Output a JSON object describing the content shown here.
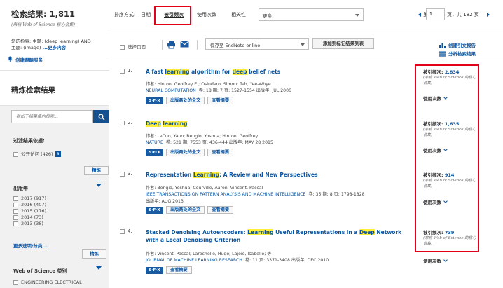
{
  "sidebar": {
    "results_title": "检索结果: 1,811",
    "results_source": "(来自 Web of Science 核心合集)",
    "query_prefix": "您的检索: 主题: (deep learning) AND",
    "query_line2": "主题: (image)",
    "query_more": "...更多内容",
    "create_alert": "创建跟踪服务",
    "refine_title": "精炼检索结果",
    "search_placeholder": "在如下结果集内检索...",
    "filter_label": "过滤结果依据:",
    "open_access": "公开访问 (426)",
    "refine_btn": "精炼",
    "year_label": "出版年",
    "years": [
      "2017 (917)",
      "2016 (407)",
      "2015 (176)",
      "2014 (73)",
      "2013 (38)"
    ],
    "more_options": "更多选项/分类...",
    "wos_category_label": "Web of Science 类别",
    "category_item": "ENGINEERING ELECTRICAL"
  },
  "sortbar": {
    "label": "排序方式:",
    "date": "日期",
    "times_cited": "被引频次",
    "usage": "使用次数",
    "relevance": "相关性",
    "more": "更多",
    "page_prefix": "第",
    "page_value": "1",
    "page_suffix": "页，共 182 页"
  },
  "toolbar": {
    "select_page": "选择页面",
    "endnote": "保存至 EndNote online",
    "add_marked": "添加到标记结果列表",
    "citation_report": "创建引文报告",
    "analyze": "分析检索结果"
  },
  "record_buttons": {
    "sfx": "S·F·X",
    "full_text": "出版商处的全文",
    "abstract": "查看摘要"
  },
  "records": [
    {
      "num": "1.",
      "title_parts": [
        "A fast ",
        "learning",
        " algorithm for ",
        "deep",
        " belief nets"
      ],
      "authors": "作者: Hinton, Geoffrey E.; Osindero, Simon; Teh, Yee-Whye",
      "journal": "NEURAL COMPUTATION",
      "meta": "卷: 18  期: 7  页: 1527-1554  出版年: JUL 2006",
      "cited": "2,834",
      "cite_label": "被引频次:",
      "cite_source": "(来自 Web of Science 的核心合集)",
      "usage": "使用次数"
    },
    {
      "num": "2.",
      "title_parts": [
        "Deep",
        " ",
        "learning"
      ],
      "authors": "作者: LeCun, Yann; Bengio, Yoshua; Hinton, Geoffrey",
      "journal": "NATURE",
      "meta": "卷: 521  期: 7553  页: 436-444  出版年: MAY 28 2015",
      "cited": "1,635",
      "cite_label": "被引频次:",
      "cite_source": "(来自 Web of Science 的核心合集)",
      "usage": "使用次数"
    },
    {
      "num": "3.",
      "title_parts": [
        "Representation ",
        "Learning",
        ": A Review and New Perspectives"
      ],
      "authors": "作者: Bengio, Yoshua; Courville, Aaron; Vincent, Pascal",
      "journal": "IEEE TRANSACTIONS ON PATTERN ANALYSIS AND MACHINE INTELLIGENCE",
      "meta": "卷: 35  期: 8  页: 1798-1828",
      "meta2": "出版年: AUG 2013",
      "cited": "914",
      "cite_label": "被引频次:",
      "cite_source": "(来自 Web of Science 的核心合集)",
      "usage": "使用次数"
    },
    {
      "num": "4.",
      "title_parts": [
        "Stacked Denoising Autoencoders: ",
        "Learning",
        " Useful Representations in a ",
        "Deep",
        " Network with a Local Denoising Criterion"
      ],
      "authors": "作者: Vincent, Pascal; Larochelle, Hugo; Lajoie, Isabelle; 等",
      "journal": "JOURNAL OF MACHINE LEARNING RESEARCH",
      "meta": "卷: 11  页: 3371-3408  出版年: DEC 2010",
      "cited": "739",
      "cite_label": "被引频次:",
      "cite_source": "(来自 Web of Science 的核心合集)",
      "usage": "使用次数"
    }
  ],
  "colors": {
    "link": "#0a55a3",
    "highlight": "#ffee3a",
    "annotation": "#e2001a",
    "search_button": "#14508e"
  }
}
